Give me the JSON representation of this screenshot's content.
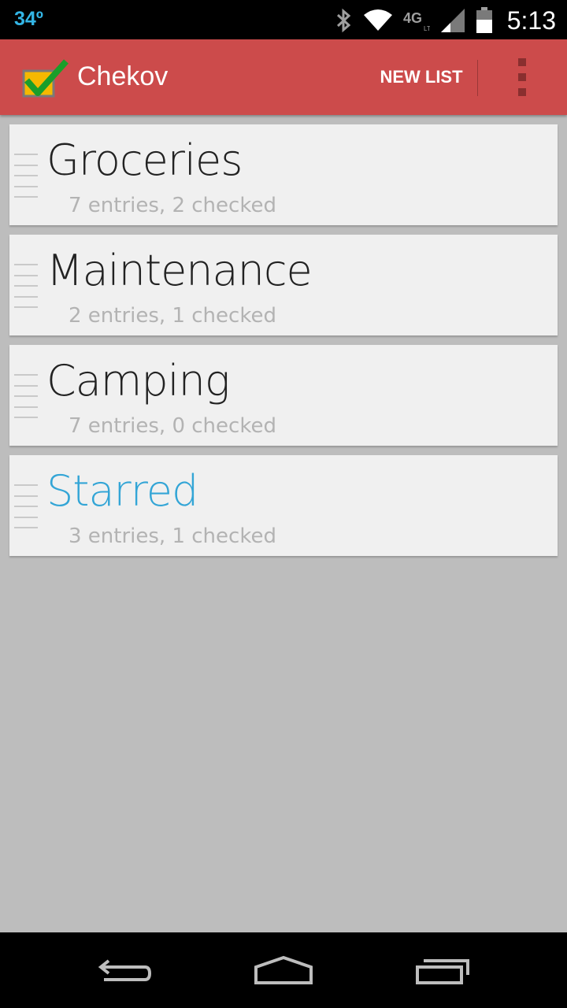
{
  "status_bar": {
    "temperature": "34º",
    "time": "5:13",
    "icons": [
      "bluetooth-icon",
      "wifi-icon",
      "4g-lte-icon",
      "signal-icon",
      "battery-icon"
    ]
  },
  "app_bar": {
    "title": "Chekov",
    "new_list_label": "NEW LIST",
    "color": "#cc4b4b"
  },
  "lists": [
    {
      "name": "Groceries",
      "summary": "7 entries, 2 checked",
      "starred": false
    },
    {
      "name": "Maintenance",
      "summary": "2 entries, 1 checked",
      "starred": false
    },
    {
      "name": "Camping",
      "summary": "7 entries, 0 checked",
      "starred": false
    },
    {
      "name": "Starred",
      "summary": "3 entries, 1 checked",
      "starred": true
    }
  ],
  "colors": {
    "accent": "#33a5d6",
    "background": "#bdbdbd"
  },
  "nav_bar": {
    "icons": [
      "back-icon",
      "home-icon",
      "recent-apps-icon"
    ]
  }
}
